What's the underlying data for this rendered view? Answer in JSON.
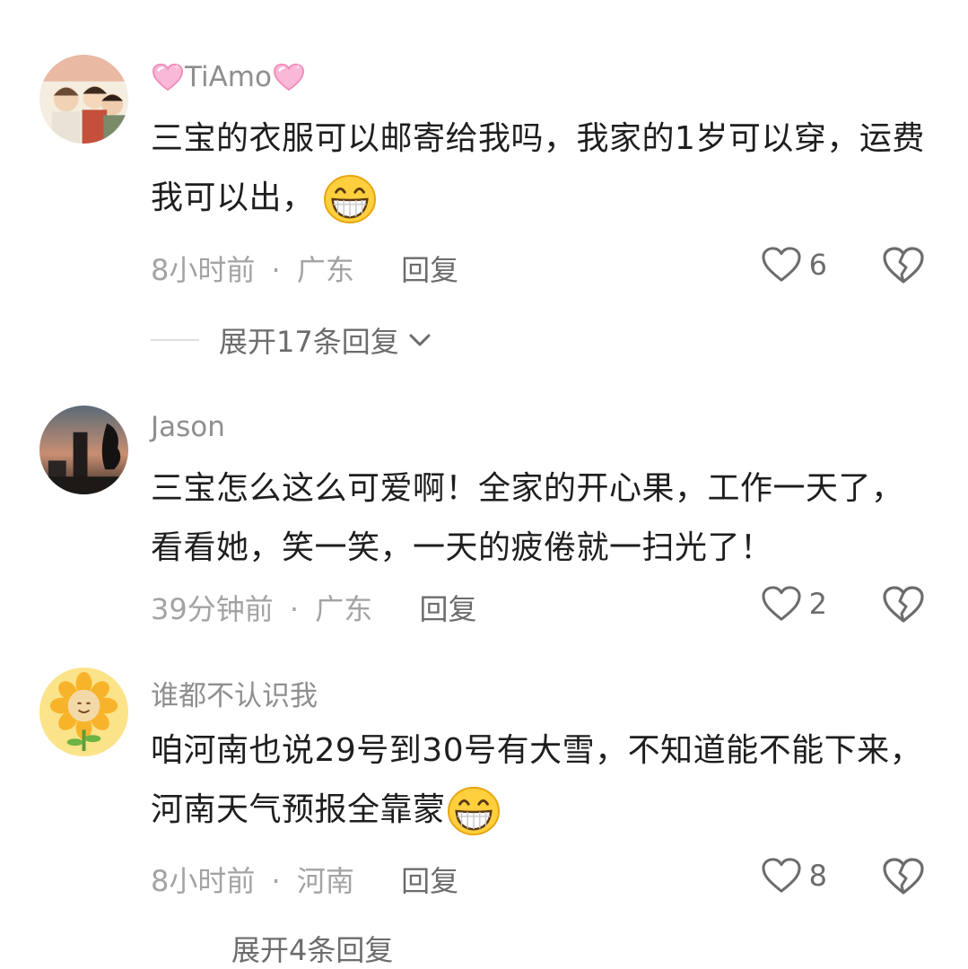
{
  "comments": [
    {
      "name": "TiAmo",
      "text": "三宝的衣服可以邮寄给我吗，我家的1岁可以穿，运费我可以出，",
      "emoji_icon": "grinning-face-icon",
      "time": "8小时前",
      "location": "广东",
      "reply_label": "回复",
      "likes": "6",
      "expand_label": "展开17条回复"
    },
    {
      "name": "Jason",
      "text": "三宝怎么这么可爱啊！全家的开心果，工作一天了，看看她，笑一笑，一天的疲倦就一扫光了！",
      "time": "39分钟前",
      "location": "广东",
      "reply_label": "回复",
      "likes": "2"
    },
    {
      "name": "谁都不认识我",
      "text": "咱河南也说29号到30号有大雪，不知道能不能下来，河南天气预报全靠蒙",
      "emoji_icon": "grinning-face-icon",
      "time": "8小时前",
      "location": "河南",
      "reply_label": "回复",
      "likes": "8",
      "expand_label": "展开4条回复"
    }
  ],
  "separator": "·",
  "colors": {
    "name": "#8f8f8f",
    "meta": "#a3a3a3",
    "text": "#1e1e1e",
    "accent_pink": "#f5a3c7"
  }
}
